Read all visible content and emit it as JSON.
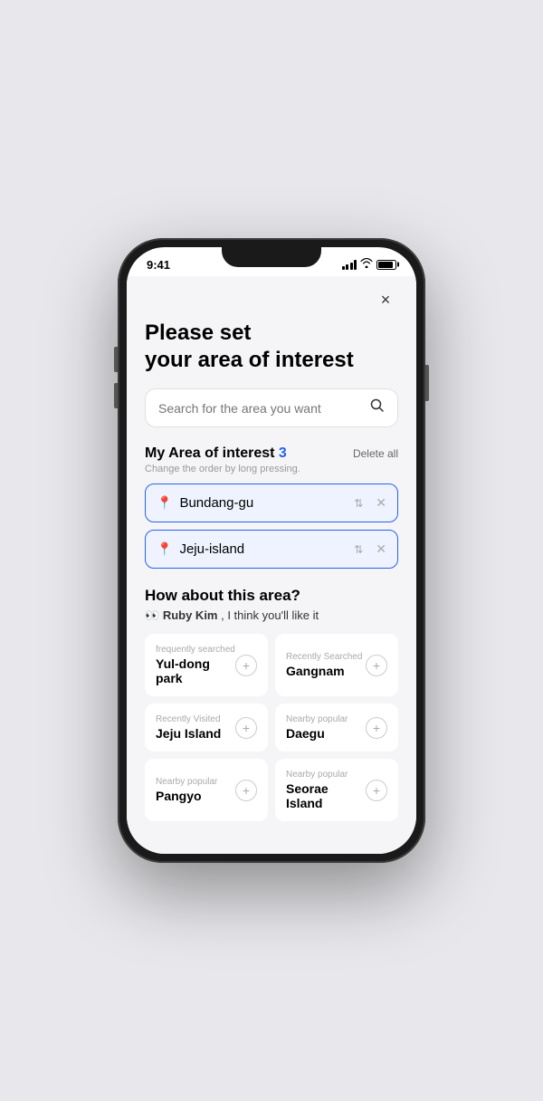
{
  "status_bar": {
    "time": "9:41",
    "signal_alt": "signal bars"
  },
  "close_button_label": "×",
  "page_title": "Please set\nyour area of interest",
  "search": {
    "placeholder": "Search for the area you want"
  },
  "my_area": {
    "title": "My Area of interest",
    "count": "3",
    "subtitle": "Change the order by long pressing.",
    "delete_all_label": "Delete all",
    "items": [
      {
        "name": "Bundang-gu"
      },
      {
        "name": "Jeju-island"
      }
    ]
  },
  "recommendation": {
    "title": "How about this area?",
    "subtitle_prefix": "👀",
    "user_name": "Ruby Kim",
    "subtitle_suffix": ", I think you'll like it",
    "cards": [
      {
        "label": "frequently searched",
        "name": "Yul-dong park"
      },
      {
        "label": "Recently Searched",
        "name": "Gangnam"
      },
      {
        "label": "Recently Visited",
        "name": "Jeju Island"
      },
      {
        "label": "Nearby popular",
        "name": "Daegu"
      },
      {
        "label": "Nearby popular",
        "name": "Pangyo"
      },
      {
        "label": "Nearby popular",
        "name": "Seorae Island"
      }
    ]
  }
}
